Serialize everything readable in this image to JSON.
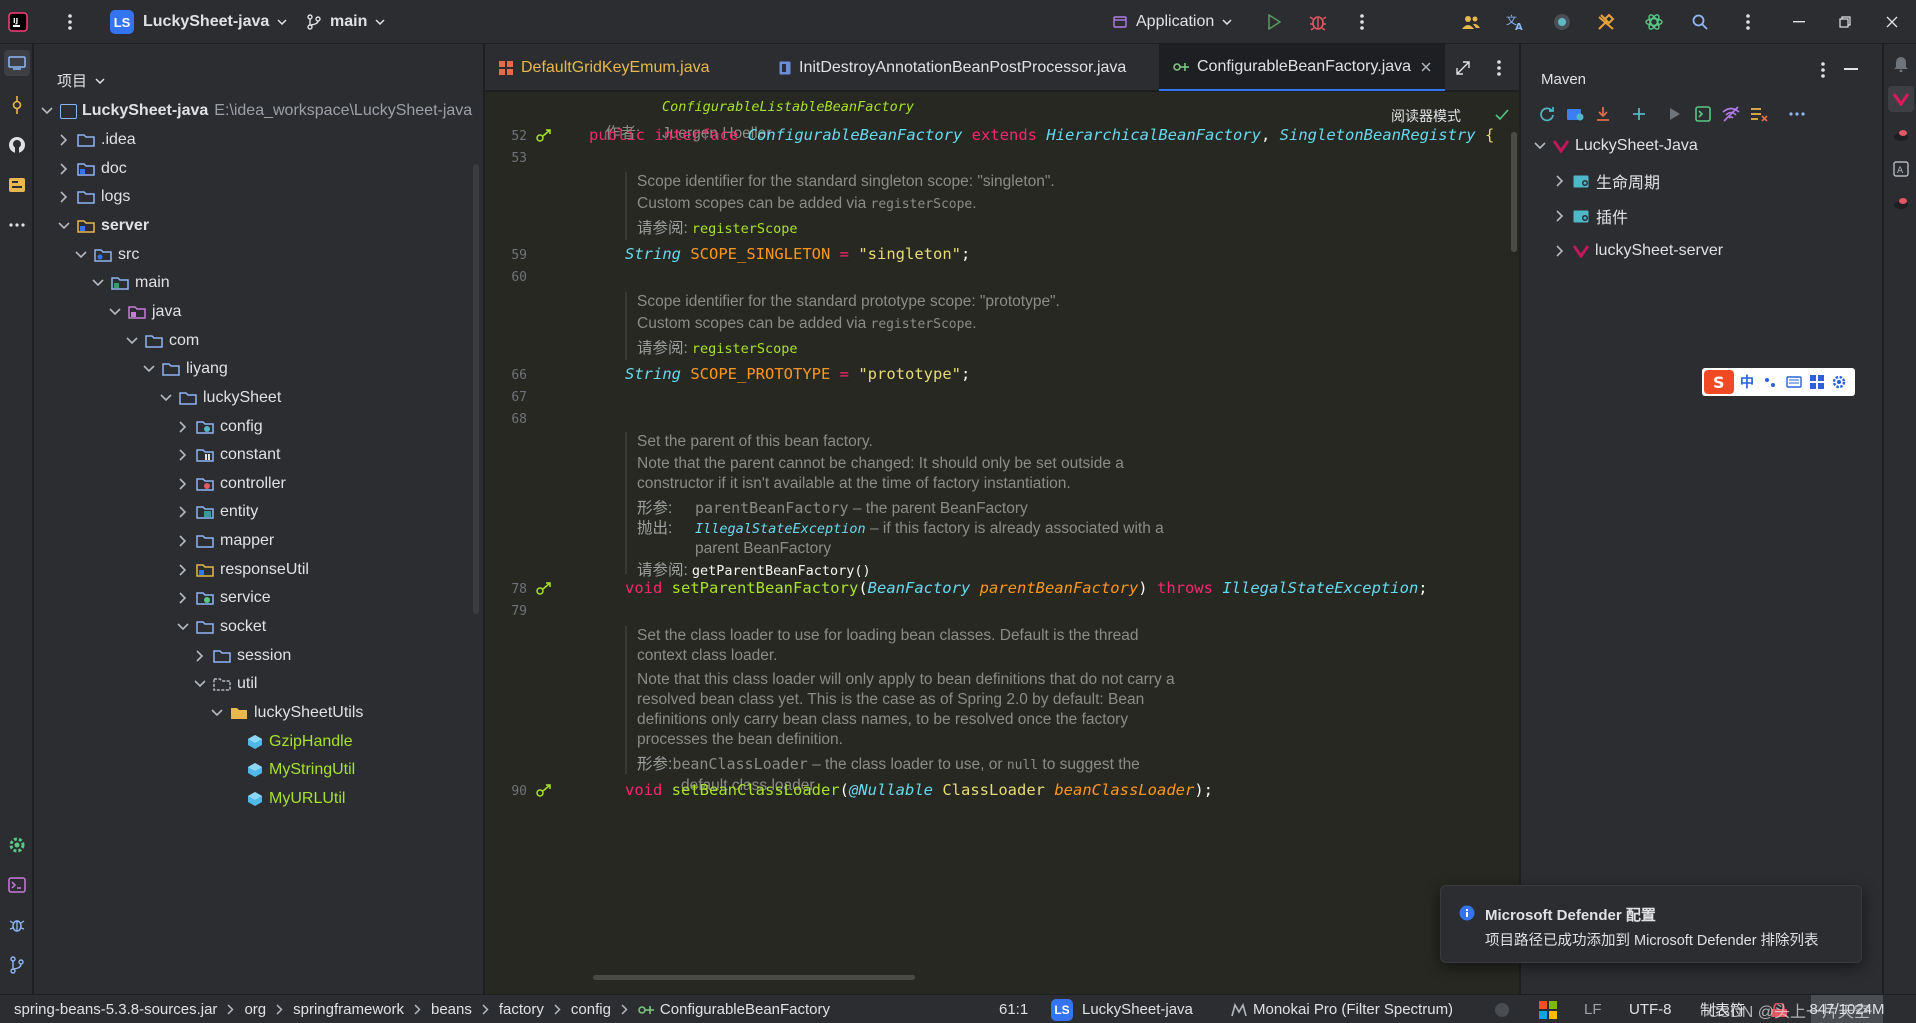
{
  "titlebar": {
    "project_badge": "LS",
    "project_name": "LuckySheet-java",
    "branch": "main",
    "run_config": "Application"
  },
  "project_panel": {
    "title": "项目",
    "root_name": "LuckySheet-java",
    "root_path": "E:\\idea_workspace\\LuckySheet-java",
    "items": [
      {
        "label": ".idea"
      },
      {
        "label": "doc"
      },
      {
        "label": "logs"
      },
      {
        "label": "server"
      },
      {
        "label": "src"
      },
      {
        "label": "main"
      },
      {
        "label": "java"
      },
      {
        "label": "com"
      },
      {
        "label": "liyang"
      },
      {
        "label": "luckySheet"
      },
      {
        "label": "config"
      },
      {
        "label": "constant"
      },
      {
        "label": "controller"
      },
      {
        "label": "entity"
      },
      {
        "label": "mapper"
      },
      {
        "label": "responseUtil"
      },
      {
        "label": "service"
      },
      {
        "label": "socket"
      },
      {
        "label": "session"
      },
      {
        "label": "util"
      },
      {
        "label": "luckySheetUtils"
      },
      {
        "label": "GzipHandle"
      },
      {
        "label": "MyStringUtil"
      },
      {
        "label": "MyURLUtil"
      }
    ]
  },
  "tabs": [
    {
      "label": "DefaultGridKeyEmum.java"
    },
    {
      "label": "InitDestroyAnnotationBeanPostProcessor.java"
    },
    {
      "label": "ConfigurableBeanFactory.java"
    }
  ],
  "editor": {
    "reader_mode": "阅读器模式",
    "header_link": "ConfigurableListableBeanFactory",
    "author_label": "作者:",
    "author": "Juergen Hoeller",
    "line_numbers": [
      "52",
      "53",
      "59",
      "60",
      "66",
      "67",
      "68",
      "78",
      "79",
      "90"
    ],
    "interface_line": {
      "kw1": "public",
      "kw2": "interface",
      "name": "ConfigurableBeanFactory",
      "kw3": "extends",
      "t1": "HierarchicalBeanFactory",
      "comma": ",",
      "t2": "SingletonBeanRegistry",
      "brace": "{"
    },
    "doc1": {
      "p1": "Scope identifier for the standard singleton scope: \"singleton\".",
      "p2a": "Custom scopes can be added via ",
      "p2code": "registerScope",
      "p2b": ".",
      "see_label": "请参阅:",
      "see": "registerScope"
    },
    "line59": {
      "type": "String",
      "name": "SCOPE_SINGLETON",
      "eq": " = ",
      "val": "\"singleton\"",
      "end": ";"
    },
    "doc2": {
      "p1": "Scope identifier for the standard prototype scope: \"prototype\".",
      "p2a": "Custom scopes can be added via ",
      "p2code": "registerScope",
      "p2b": ".",
      "see_label": "请参阅:",
      "see": "registerScope"
    },
    "line66": {
      "type": "String",
      "name": "SCOPE_PROTOTYPE",
      "eq": " = ",
      "val": "\"prototype\"",
      "end": ";"
    },
    "doc3": {
      "p1": "Set the parent of this bean factory.",
      "p2": "Note that the parent cannot be changed: It should only be set outside a",
      "p3": "constructor if it isn't available at the time of factory instantiation.",
      "param_label": "形参:",
      "param_name": "parentBeanFactory",
      "param_desc": " – the parent BeanFactory",
      "throws_label": "抛出:",
      "throws_name": "IllegalStateException",
      "throws_desc": " – if this factory is already associated with a",
      "throws_desc2": "parent BeanFactory",
      "see_label": "请参阅:",
      "see": "getParentBeanFactory()"
    },
    "line78": {
      "kw": "void",
      "fn": "setParentBeanFactory",
      "open": "(",
      "ptype": "BeanFactory",
      "pname": "parentBeanFactory",
      "close": ")",
      "throws": "throws",
      "ex": "IllegalStateException",
      "end": ";"
    },
    "doc4": {
      "p1": "Set the class loader to use for loading bean classes. Default is the thread",
      "p1b": "context class loader.",
      "p2": "Note that this class loader will only apply to bean definitions that do not carry a",
      "p3": "resolved bean class yet. This is the case as of Spring 2.0 by default: Bean",
      "p4": "definitions only carry bean class names, to be resolved once the factory",
      "p5": "processes the bean definition.",
      "param_label": "形参:",
      "param_name": "beanClassLoader",
      "param_desc": " – the class loader to use, or ",
      "param_null": "null",
      "param_desc2": " to suggest the",
      "param_desc3": "default class loader"
    },
    "line90": {
      "kw": "void",
      "fn": "setBeanClassLoader",
      "open": "(",
      "ann": "@Nullable",
      "ptype": "ClassLoader",
      "pname": "beanClassLoader",
      "close": ");"
    }
  },
  "maven": {
    "title": "Maven",
    "root": "LuckySheet-Java",
    "items": [
      {
        "label": "生命周期"
      },
      {
        "label": "插件"
      },
      {
        "label": "luckySheet-server"
      }
    ]
  },
  "ime": {
    "label": "中"
  },
  "notification": {
    "title": "Microsoft Defender 配置",
    "body": "项目路径已成功添加到 Microsoft Defender 排除列表"
  },
  "statusbar": {
    "breadcrumbs": [
      "spring-beans-5.3.8-sources.jar",
      "org",
      "springframework",
      "beans",
      "factory",
      "config",
      "ConfigurableBeanFactory"
    ],
    "position": "61:1",
    "project_badge": "LS",
    "project": "LuckySheet-java",
    "theme": "Monokai Pro (Filter Spectrum)",
    "line_ending": "LF",
    "encoding": "UTF-8",
    "readonly": "制表符",
    "memory": "847/1024M",
    "watermark": "CSDN @头上一片天空"
  }
}
